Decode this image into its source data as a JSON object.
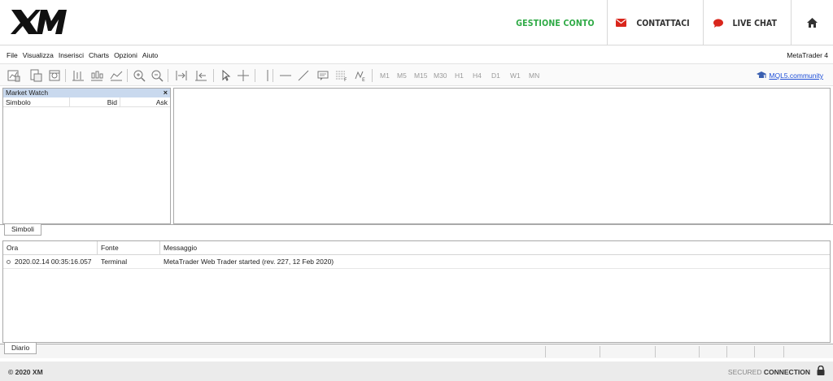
{
  "header": {
    "logo_text": "XM",
    "gestione": "GESTIONE CONTO",
    "contattaci": "CONTATTACI",
    "livechat": "LIVE CHAT",
    "icons": {
      "mail": "mail-icon",
      "chat": "chat-bubble-icon",
      "home": "home-icon"
    },
    "colors": {
      "green": "#2eaa45",
      "red": "#d9261c"
    }
  },
  "menu": {
    "items": [
      "File",
      "Visualizza",
      "Inserisci",
      "Charts",
      "Opzioni",
      "Aiuto"
    ],
    "brand": "MetaTrader 4"
  },
  "toolbar": {
    "timeframes": [
      "M1",
      "M5",
      "M15",
      "M30",
      "H1",
      "H4",
      "D1",
      "W1",
      "MN"
    ],
    "mql": "MQL5.community"
  },
  "market_watch": {
    "title": "Market Watch",
    "close": "×",
    "columns": [
      "Simbolo",
      "Bid",
      "Ask"
    ],
    "tab": "Simboli"
  },
  "journal": {
    "columns": [
      "Ora",
      "Fonte",
      "Messaggio"
    ],
    "rows": [
      {
        "time": "2020.02.14 00:35:16.057",
        "source": "Terminal",
        "message": "MetaTrader Web Trader started (rev. 227, 12 Feb 2020)"
      }
    ],
    "tab": "Diario"
  },
  "footer": {
    "copyright": "© 2020 XM",
    "secured": "SECURED",
    "connection": "CONNECTION"
  }
}
